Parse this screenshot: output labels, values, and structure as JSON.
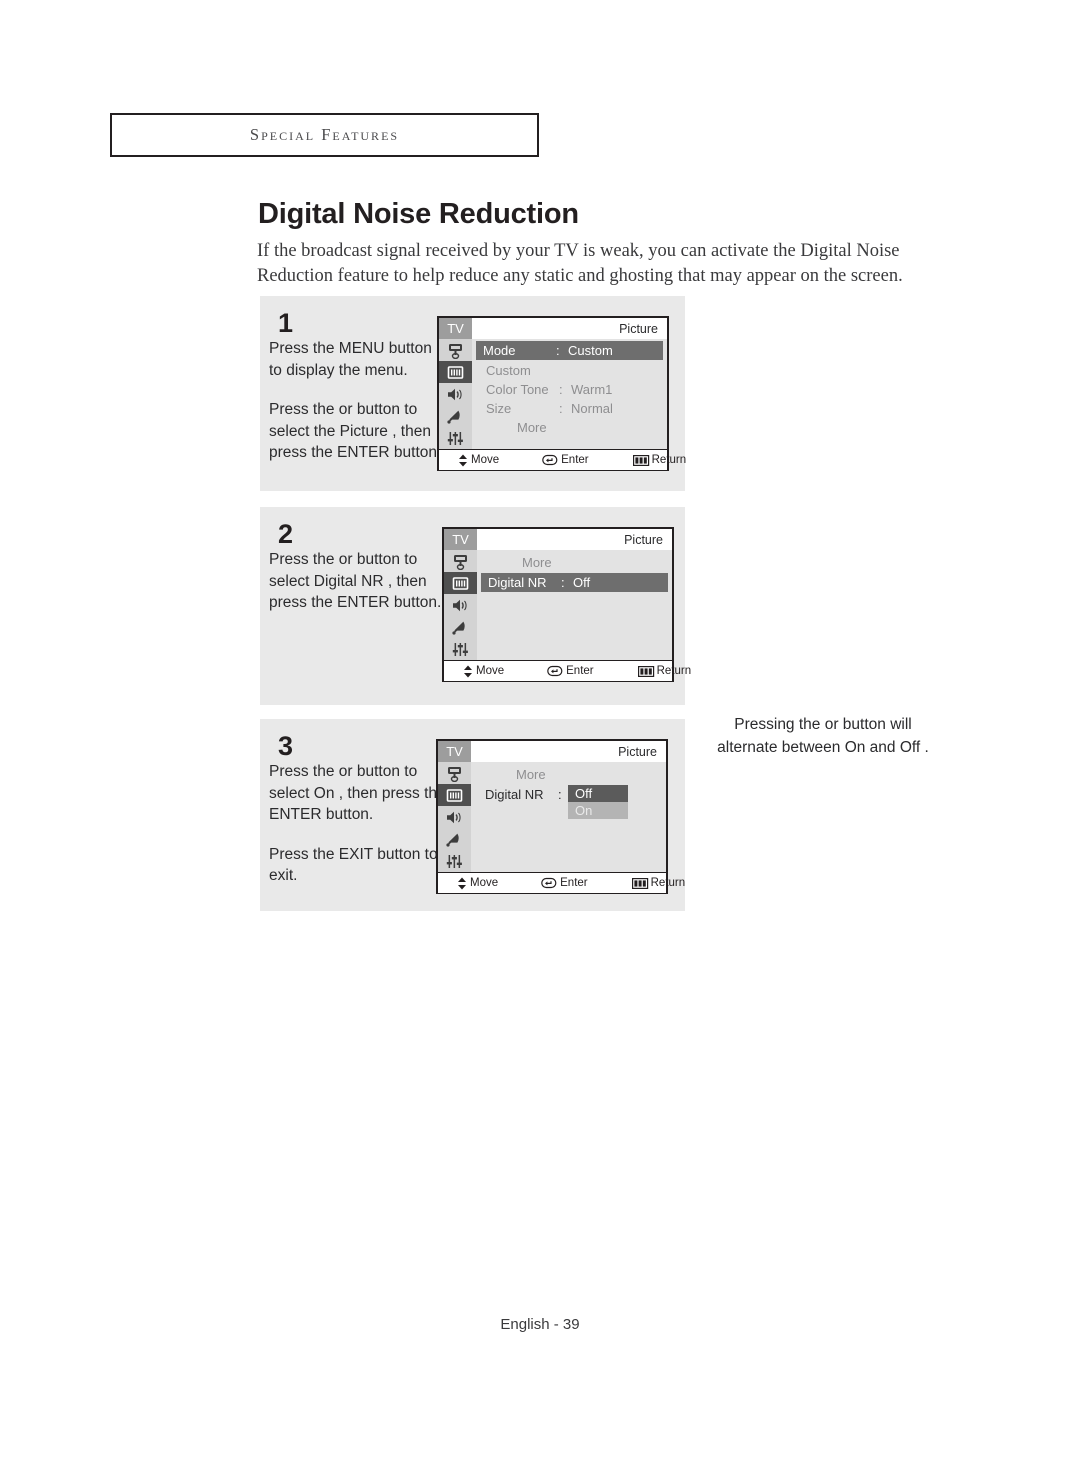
{
  "header": {
    "chapter_label": "Special Features"
  },
  "page": {
    "title": "Digital Noise Reduction",
    "intro": "If the broadcast signal received by your TV is weak, you can activate the Digital Noise Reduction feature to help reduce any static and ghosting that may appear on the screen.",
    "footer": "English - 39"
  },
  "side_note": {
    "line1": "Pressing the  or   button will",
    "line2": "alternate between  On  and  Off ."
  },
  "steps": [
    {
      "number": "1",
      "paragraphs": [
        "Press the MENU button to display the menu.",
        "Press the  or   button to select the  Picture , then press the ENTER button."
      ]
    },
    {
      "number": "2",
      "paragraphs": [
        "Press the  or   button to select  Digital NR , then press the ENTER button."
      ]
    },
    {
      "number": "3",
      "paragraphs": [
        "Press the  or   button to select  On , then press the ENTER button.",
        "Press the EXIT button to exit."
      ]
    }
  ],
  "osd": {
    "tv_label": "TV",
    "title": "Picture",
    "rail_icons": [
      "input-jack-icon",
      "picture-icon",
      "speaker-icon",
      "satellite-dish-icon",
      "setup-sliders-icon"
    ],
    "bottom_bar": {
      "move": "Move",
      "enter": "Enter",
      "return": "Return"
    },
    "screen1": {
      "rows": [
        {
          "label": "Mode",
          "colon": ":",
          "value": "Custom",
          "highlighted": true
        },
        {
          "label": "Custom",
          "colon": "",
          "value": "",
          "highlighted": false
        },
        {
          "label": "Color Tone",
          "colon": ":",
          "value": "Warm1",
          "highlighted": false
        },
        {
          "label": "Size",
          "colon": ":",
          "value": "Normal",
          "highlighted": false
        },
        {
          "label": "More",
          "colon": "",
          "value": "",
          "highlighted": false,
          "centered": true
        }
      ]
    },
    "screen2": {
      "rows": [
        {
          "label": "More",
          "colon": "",
          "value": "",
          "highlighted": false,
          "centered": true
        },
        {
          "label": "Digital NR",
          "colon": ":",
          "value": "Off",
          "highlighted": true
        }
      ]
    },
    "screen3": {
      "rows": [
        {
          "label": "More",
          "colon": "",
          "value": "",
          "highlighted": false,
          "centered": true
        },
        {
          "label": "Digital NR",
          "colon": ":",
          "value": "O",
          "highlighted": false
        }
      ],
      "dropdown": {
        "selected": "Off",
        "other": "On"
      }
    },
    "colors": {
      "panel_bg": "#e9e9e9",
      "osd_bg": "#e3e3e3",
      "rail_bg": "#d3d3d3",
      "rail_active": "#4f4f4f",
      "row_highlight": "#6e6e6e",
      "tv_tag": "#9d9d9d",
      "border": "#231f20"
    }
  }
}
